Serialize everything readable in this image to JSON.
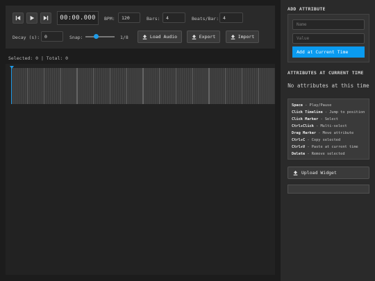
{
  "transport": {
    "time": "00:00.000",
    "buttons": [
      "skip-back",
      "play",
      "skip-forward"
    ]
  },
  "controls": {
    "bpm_label": "BPM:",
    "bpm_value": "120",
    "bars_label": "Bars:",
    "bars_value": "4",
    "beats_label": "Beats/Bar:",
    "beats_value": "4",
    "decay_label": "Decay (s):",
    "decay_value": "0",
    "snap_label": "Snap:",
    "snap_value": "1/8",
    "snap_level": 0.33,
    "load_audio": "Load Audio",
    "export": "Export",
    "import": "Import"
  },
  "status": {
    "text": "Selected: 0 | Total: 0"
  },
  "timeline": {
    "bars": 4,
    "beats_per_bar": 4,
    "subdivisions": 8,
    "accent_color": "#1e9be8"
  },
  "sidebar": {
    "add_title": "ADD ATTRIBUTE",
    "name_placeholder": "Name",
    "value_placeholder": "Value",
    "add_button": "Add at Current Time",
    "current_title": "ATTRIBUTES AT CURRENT TIME",
    "empty_text": "No attributes at this time",
    "shortcuts": [
      {
        "key": "Space",
        "desc": "- Play/Pause"
      },
      {
        "key": "Click Timeline",
        "desc": "- Jump to position"
      },
      {
        "key": "Click Marker",
        "desc": "- Select"
      },
      {
        "key": "Ctrl+Click",
        "desc": "- Multi-select"
      },
      {
        "key": "Drag Marker",
        "desc": "- Move attribute"
      },
      {
        "key": "Ctrl+C",
        "desc": "- Copy selected"
      },
      {
        "key": "Ctrl+V",
        "desc": "- Paste at current time"
      },
      {
        "key": "Delete",
        "desc": "- Remove selected"
      }
    ],
    "upload_widget": "Upload Widget",
    "button_color": "#0a9bf0"
  }
}
